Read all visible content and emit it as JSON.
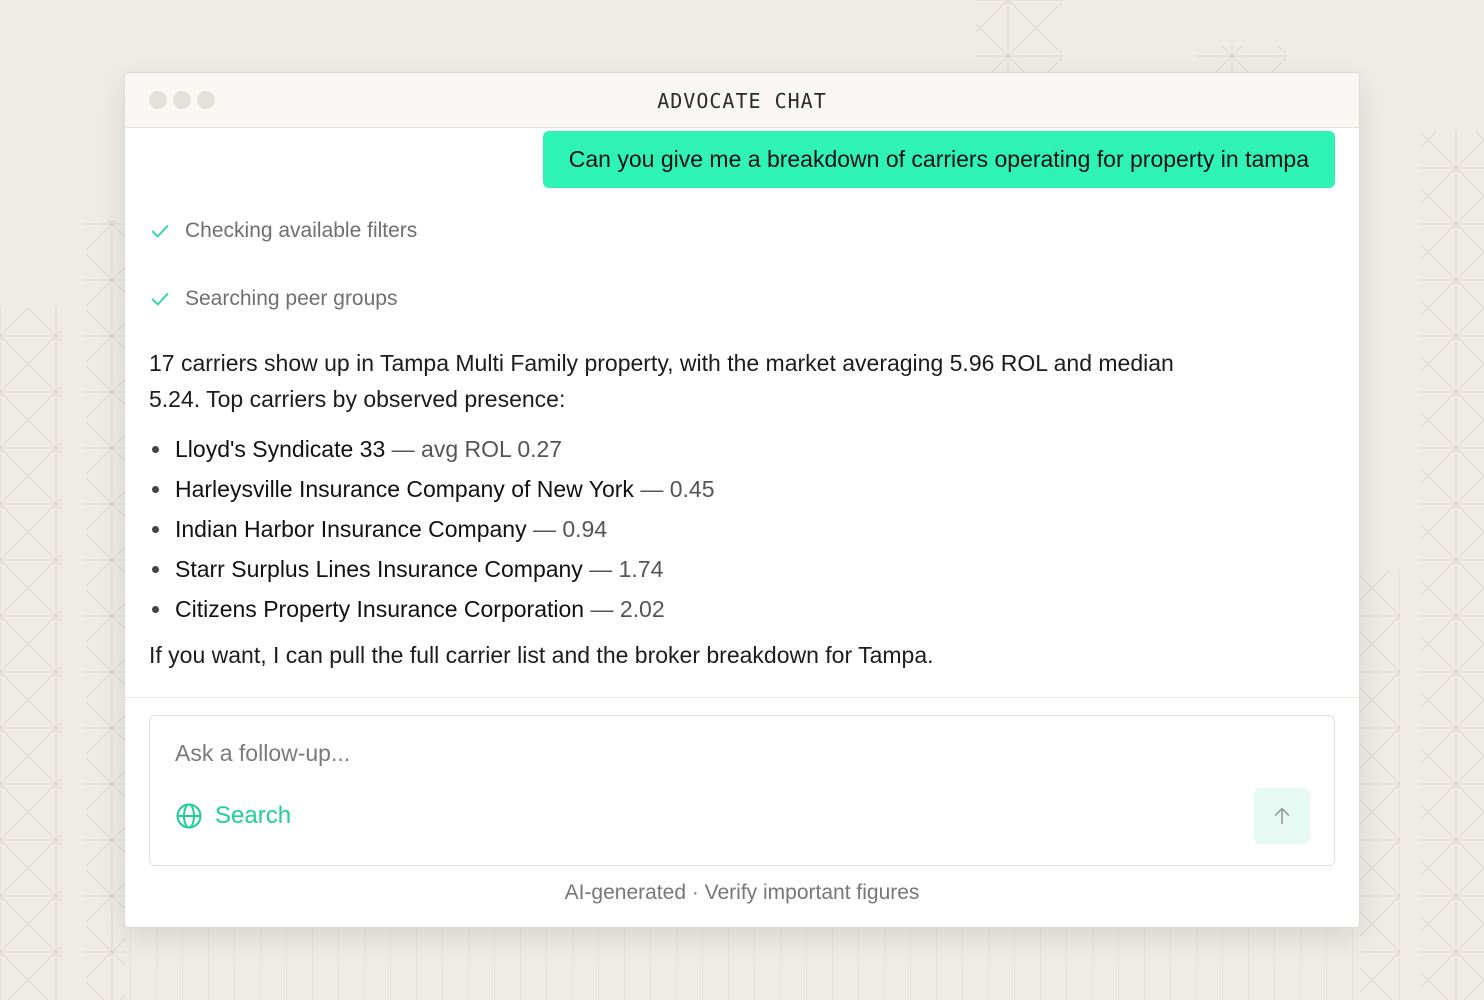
{
  "window": {
    "title": "ADVOCATE CHAT"
  },
  "chat": {
    "user_message": "Can you give me a breakdown of carriers operating for property in tampa",
    "steps": [
      {
        "label": "Checking available filters",
        "icon": "check-icon"
      },
      {
        "label": "Searching peer groups",
        "icon": "check-icon"
      }
    ],
    "answer": {
      "intro": "17 carriers show up in Tampa Multi Family property, with the market averaging 5.96 ROL and median 5.24. Top carriers by observed presence:",
      "carriers": [
        {
          "name": "Lloyd's Syndicate 33",
          "value": " — avg ROL 0.27"
        },
        {
          "name": "Harleysville Insurance Company of New York",
          "value": " — 0.45"
        },
        {
          "name": "Indian Harbor Insurance Company",
          "value": " — 0.94"
        },
        {
          "name": "Starr Surplus Lines Insurance Company",
          "value": " — 1.74"
        },
        {
          "name": "Citizens Property Insurance Corporation",
          "value": " — 2.02"
        }
      ],
      "closing": "If you want, I can pull the full carrier list and the broker breakdown for Tampa."
    }
  },
  "composer": {
    "placeholder": "Ask a follow-up...",
    "search_label": "Search",
    "search_icon": "globe-icon",
    "send_icon": "arrow-up-icon"
  },
  "footer": {
    "disclaimer": "AI-generated · Verify important figures"
  },
  "colors": {
    "accent": "#2ef3b5",
    "accent_text": "#1fcf98",
    "background": "#efece6"
  }
}
